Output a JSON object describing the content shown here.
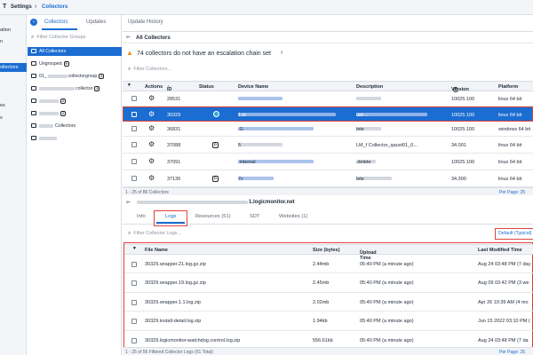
{
  "topbar": {
    "app_char": "T",
    "settings": "Settings",
    "section": "Collectors"
  },
  "leftnav": {
    "items": [
      {
        "label": "ation"
      },
      {
        "label": "n"
      },
      {
        "label": "ollectors"
      },
      {
        "label": "es"
      },
      {
        "label": "s"
      }
    ]
  },
  "groups_panel": {
    "tabs": [
      "Collectors",
      "Updates",
      "Update History"
    ],
    "search_placeholder": "Filter Collector Groups",
    "items": [
      {
        "label": "All Collectors",
        "count": ""
      },
      {
        "label": "Ungrouped",
        "count": "9"
      },
      {
        "label": "01_",
        "suffix": "collectorgroup",
        "count": "2"
      },
      {
        "label": "",
        "suffix": "collector",
        "count": "2"
      },
      {
        "label": "",
        "suffix": "",
        "count": "2"
      },
      {
        "label": "",
        "suffix": "",
        "count": "2"
      },
      {
        "label": "",
        "suffix": "Collectors",
        "count": ""
      },
      {
        "label": "",
        "suffix": "",
        "count": ""
      }
    ]
  },
  "main": {
    "breadcrumb": "All Collectors",
    "alert": "74 collectors do not have an escalation chain set",
    "search_placeholder": "Filter Collectors...",
    "columns": {
      "actions": "Actions",
      "id": "ID",
      "status": "Status",
      "device": "Device Name",
      "description": "Description",
      "version": "Version",
      "platform": "Platform"
    },
    "rows": [
      {
        "id": "28531",
        "device": "",
        "description": "",
        "version": "10025.100",
        "platform": "linux 64 bit",
        "status": ""
      },
      {
        "id": "30329",
        "device": "1.lo",
        "description": "ust-...",
        "version": "10025.100",
        "platform": "linux 64 bit",
        "status": "cyan"
      },
      {
        "id": "36831",
        "device": ".G",
        "description": "lete",
        "version": "10025.100",
        "platform": "windows 64 bit",
        "status": ""
      },
      {
        "id": "37088",
        "device": "5",
        "description": "LM_f Collector_qaust01_0...",
        "version": "34.001",
        "platform": "linux 64 bit",
        "status": "badge"
      },
      {
        "id": "37091",
        "device": ".internal",
        "description": ".delete",
        "version": "10025.100",
        "platform": "linux 64 bit",
        "status": ""
      },
      {
        "id": "37136",
        "device": "7c",
        "description": "lete",
        "version": "34.300",
        "platform": "linux 64 bit",
        "status": "badge"
      }
    ],
    "footer_range": "1 - 25 of 86 Collectors",
    "per_page": "Per Page: 25",
    "detail_host": "1.logicmonitor.net",
    "detail_tabs": [
      "Info",
      "Logs",
      "Resources (51)",
      "SDT",
      "Websites (1)"
    ],
    "logs_search_placeholder": "Filter Collector Logs...",
    "default_sort": "Default (Typical)",
    "log_columns": {
      "file": "File Name",
      "size": "Size (bytes)",
      "upload": "Upload Time",
      "modified": "Last Modified Time"
    },
    "logs": [
      {
        "file": "30329.wrapper.21.log.gz.zip",
        "size": "2.44mb",
        "upload": "05:40 PM (a minute ago)",
        "modified": "Aug 24 03:48 PM (7 day"
      },
      {
        "file": "30329.wrapper.19.log.gz.zip",
        "size": "2.45mb",
        "upload": "05:40 PM (a minute ago)",
        "modified": "Aug 09 03:42 PM (3 we"
      },
      {
        "file": "30329.wrapper.1.1.log.zip",
        "size": "2.02mb",
        "upload": "05:40 PM (a minute ago)",
        "modified": "Apr 26 10:39 AM (4 mo"
      },
      {
        "file": "30329.install-detail.log.zip",
        "size": "1.94kb",
        "upload": "05:40 PM (a minute ago)",
        "modified": "Jun 15 2022 03:10 PM ("
      },
      {
        "file": "30329.logicmonitor-watchdog.control.log.zip",
        "size": "556.61kb",
        "upload": "05:40 PM (a minute ago)",
        "modified": "Aug 24 03:48 PM (7 da"
      }
    ],
    "logs_footer": "1 - 25 of 56 Filtered Collector Logs (61 Total)",
    "logs_per_page": "Per Page: 25"
  },
  "colors": {
    "accent": "#1b6dd1",
    "highlight": "#e0413a",
    "status": "#2bb3c9",
    "warning": "#f08c1c"
  }
}
